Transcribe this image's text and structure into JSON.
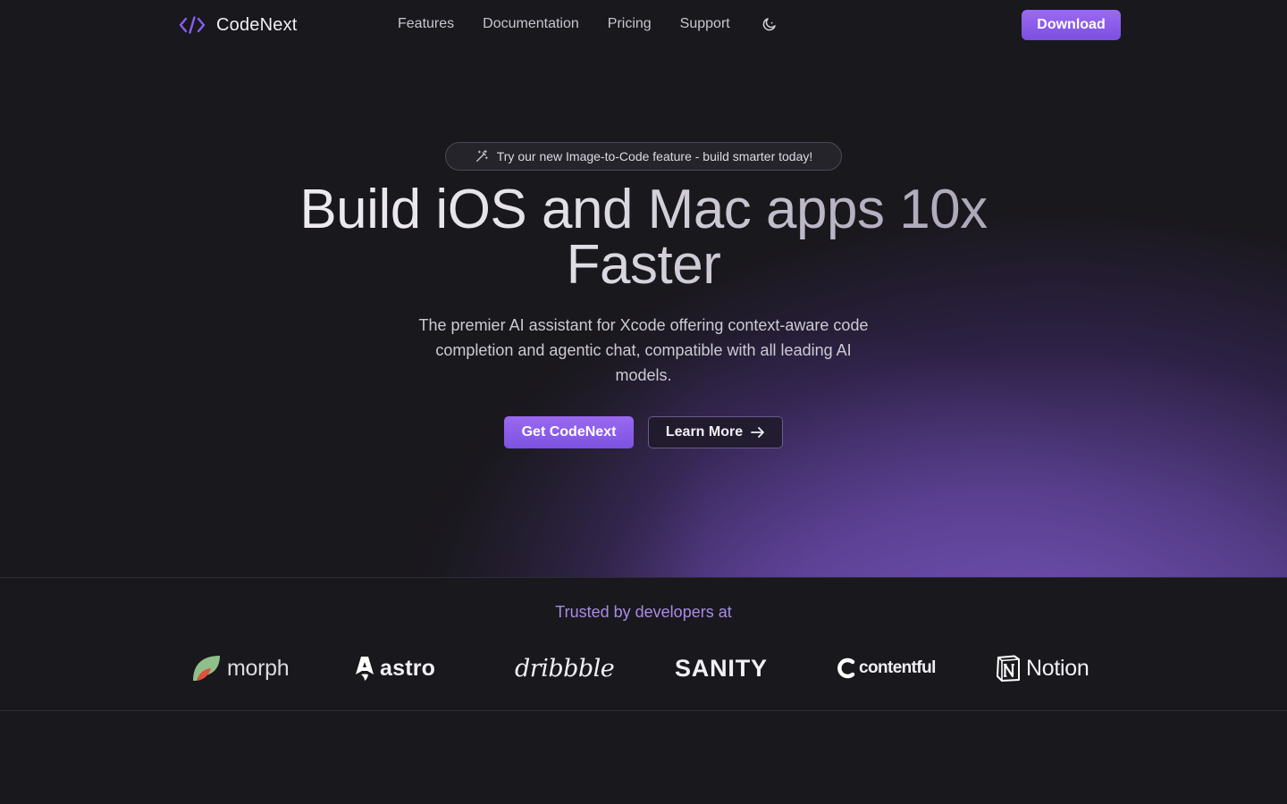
{
  "nav": {
    "brand_name": "CodeNext",
    "links": [
      "Features",
      "Documentation",
      "Pricing",
      "Support"
    ],
    "download_label": "Download"
  },
  "hero": {
    "announcement": "Try our new Image-to-Code feature - build smarter today!",
    "headline_line1": "Build iOS and Mac apps 10x",
    "headline_line2": "Faster",
    "subtext": "The premier AI assistant for Xcode offering context-aware code completion and agentic chat, compatible with all leading AI models.",
    "primary_cta": "Get CodeNext",
    "secondary_cta": "Learn More"
  },
  "trusted": {
    "title": "Trusted by developers at",
    "logos": [
      "morph",
      "astro",
      "dribbble",
      "SANITY",
      "contentful",
      "Notion"
    ]
  },
  "colors": {
    "accent": "#8b5cf6",
    "background": "#19181c",
    "trusted_title": "#a98be8"
  },
  "icons": {
    "brand": "code-brackets-icon",
    "theme": "moon-icon",
    "announcement": "magic-wand-icon",
    "cta_arrow": "arrow-right-icon"
  }
}
